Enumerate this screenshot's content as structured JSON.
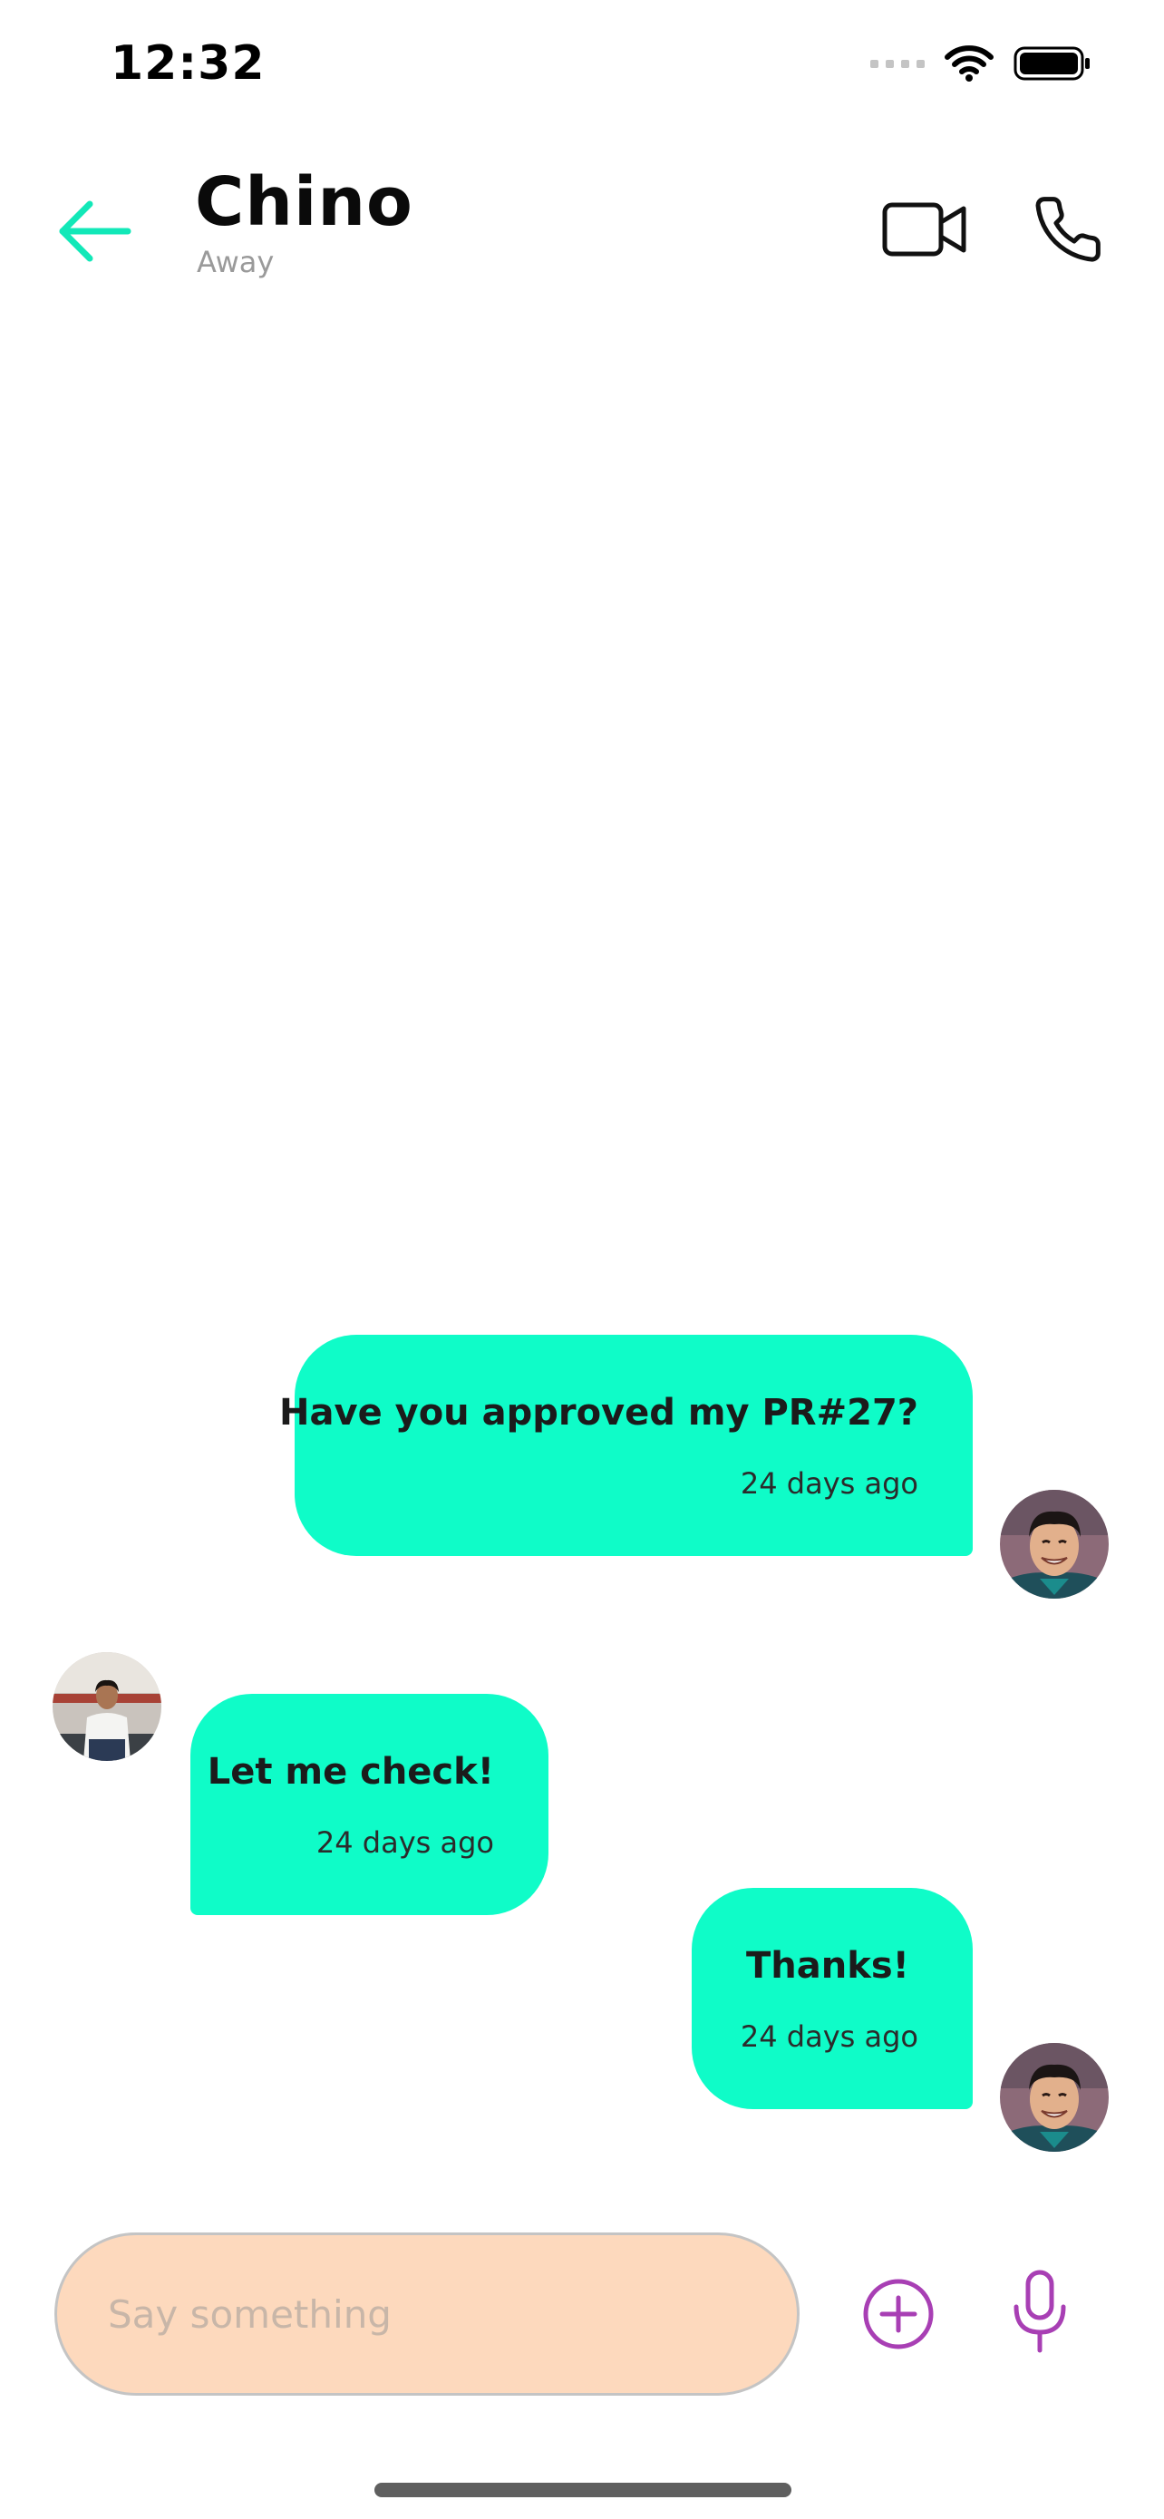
{
  "status_bar": {
    "time": "12:32"
  },
  "header": {
    "contact_name": "Chino",
    "contact_status": "Away",
    "icons": {
      "back": "arrow-left-icon",
      "video": "video-camera-icon",
      "phone": "phone-icon"
    }
  },
  "messages": [
    {
      "direction": "sent",
      "text": "Have you approved my PR#27?",
      "time": "24 days ago"
    },
    {
      "direction": "received",
      "text": "Let me check!",
      "time": "24 days ago"
    },
    {
      "direction": "sent",
      "text": "Thanks!",
      "time": "24 days ago"
    }
  ],
  "composer": {
    "placeholder": "Say something",
    "value": "",
    "icons": {
      "add": "plus-circle-icon",
      "mic": "microphone-icon"
    }
  },
  "colors": {
    "accent": "#0ffcc8",
    "input_background": "#fdd9bd",
    "composer_icons": "#a83fb4",
    "status_text": "#9a9a9a"
  }
}
